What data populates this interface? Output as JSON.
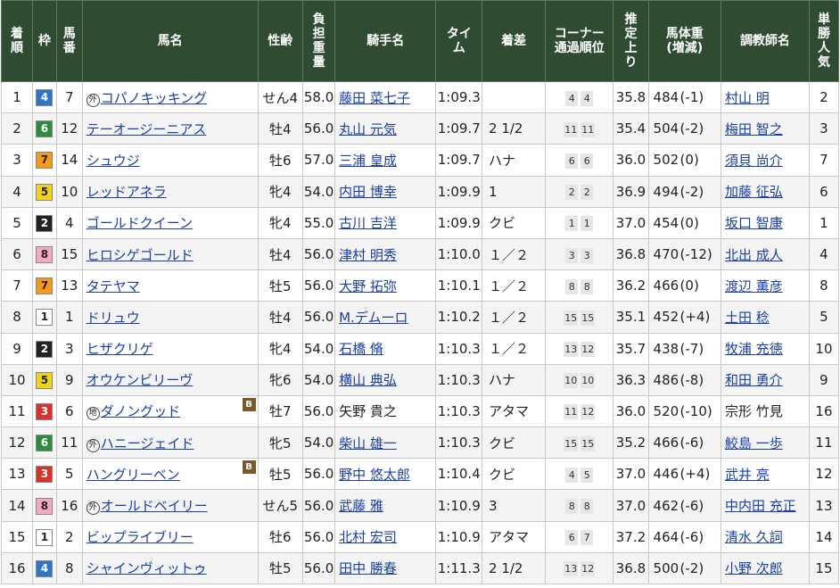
{
  "headers": {
    "rank": "着順",
    "waku": "枠",
    "umaban": "馬番",
    "horse": "馬名",
    "sexage": "性齢",
    "load": "負担重量",
    "jockey": "騎手名",
    "time": "タイム",
    "margin": "着差",
    "corner_1": "コーナー",
    "corner_2": "通過順位",
    "last3f": "推定上り",
    "weight_1": "馬体重",
    "weight_2": "(増減)",
    "trainer": "調教師名",
    "pop": "単勝人気"
  },
  "colors": {
    "header_bg": "#2f4c33",
    "link": "#1a3fa8",
    "blinker": "#7a5a2a"
  },
  "waku_colors": {
    "1": {
      "bg": "#ffffff",
      "fg": "#222222"
    },
    "2": {
      "bg": "#222222",
      "fg": "#ffffff"
    },
    "3": {
      "bg": "#d9312b",
      "fg": "#ffffff"
    },
    "4": {
      "bg": "#2f74c8",
      "fg": "#ffffff"
    },
    "5": {
      "bg": "#f1d21c",
      "fg": "#222222"
    },
    "6": {
      "bg": "#2e8c3e",
      "fg": "#ffffff"
    },
    "7": {
      "bg": "#f39a1d",
      "fg": "#222222"
    },
    "8": {
      "bg": "#f4a9c1",
      "fg": "#222222"
    }
  },
  "rows": [
    {
      "rank": "1",
      "waku": "4",
      "umaban": "7",
      "mark": "外",
      "horse": "コパノキッキング",
      "blinker": "",
      "sex": "せん4",
      "load": "58.0",
      "jockey": "藤田 菜七子",
      "jockey_link": true,
      "time": "1:09.3",
      "margin": "",
      "c1": "4",
      "c2": "4",
      "last3f": "35.8",
      "weight": "484",
      "diff": "(-1)",
      "trainer": "村山 明",
      "trainer_link": true,
      "pop": "2"
    },
    {
      "rank": "2",
      "waku": "6",
      "umaban": "12",
      "mark": "",
      "horse": "テーオージーニアス",
      "blinker": "",
      "sex": "牡4",
      "load": "56.0",
      "jockey": "丸山 元気",
      "jockey_link": true,
      "time": "1:09.7",
      "margin": "2 1/2",
      "c1": "11",
      "c2": "11",
      "last3f": "35.4",
      "weight": "504",
      "diff": "(-2)",
      "trainer": "梅田 智之",
      "trainer_link": true,
      "pop": "3"
    },
    {
      "rank": "3",
      "waku": "7",
      "umaban": "14",
      "mark": "",
      "horse": "シュウジ",
      "blinker": "",
      "sex": "牡6",
      "load": "57.0",
      "jockey": "三浦 皇成",
      "jockey_link": true,
      "time": "1:09.7",
      "margin": "ハナ",
      "c1": "6",
      "c2": "6",
      "last3f": "36.0",
      "weight": "502",
      "diff": "(0)",
      "trainer": "須貝 尚介",
      "trainer_link": true,
      "pop": "7"
    },
    {
      "rank": "4",
      "waku": "5",
      "umaban": "10",
      "mark": "",
      "horse": "レッドアネラ",
      "blinker": "",
      "sex": "牝4",
      "load": "54.0",
      "jockey": "内田 博幸",
      "jockey_link": true,
      "time": "1:09.9",
      "margin": "1",
      "c1": "2",
      "c2": "2",
      "last3f": "36.9",
      "weight": "494",
      "diff": "(-2)",
      "trainer": "加藤 征弘",
      "trainer_link": true,
      "pop": "6"
    },
    {
      "rank": "5",
      "waku": "2",
      "umaban": "4",
      "mark": "",
      "horse": "ゴールドクイーン",
      "blinker": "",
      "sex": "牝4",
      "load": "55.0",
      "jockey": "古川 吉洋",
      "jockey_link": true,
      "time": "1:09.9",
      "margin": "クビ",
      "c1": "1",
      "c2": "1",
      "last3f": "37.0",
      "weight": "454",
      "diff": "(0)",
      "trainer": "坂口 智康",
      "trainer_link": true,
      "pop": "1"
    },
    {
      "rank": "6",
      "waku": "8",
      "umaban": "15",
      "mark": "",
      "horse": "ヒロシゲゴールド",
      "blinker": "",
      "sex": "牡4",
      "load": "56.0",
      "jockey": "津村 明秀",
      "jockey_link": true,
      "time": "1:10.0",
      "margin": "１／２",
      "c1": "3",
      "c2": "3",
      "last3f": "36.8",
      "weight": "470",
      "diff": "(-12)",
      "trainer": "北出 成人",
      "trainer_link": true,
      "pop": "4"
    },
    {
      "rank": "7",
      "waku": "7",
      "umaban": "13",
      "mark": "",
      "horse": "タテヤマ",
      "blinker": "",
      "sex": "牡5",
      "load": "56.0",
      "jockey": "大野 拓弥",
      "jockey_link": true,
      "time": "1:10.1",
      "margin": "１／２",
      "c1": "8",
      "c2": "8",
      "last3f": "36.2",
      "weight": "466",
      "diff": "(0)",
      "trainer": "渡辺 薫彦",
      "trainer_link": true,
      "pop": "8"
    },
    {
      "rank": "8",
      "waku": "1",
      "umaban": "1",
      "mark": "",
      "horse": "ドリュウ",
      "blinker": "",
      "sex": "牡4",
      "load": "56.0",
      "jockey": "M.デムーロ",
      "jockey_link": true,
      "time": "1:10.2",
      "margin": "１／２",
      "c1": "15",
      "c2": "15",
      "last3f": "35.1",
      "weight": "452",
      "diff": "(+4)",
      "trainer": "土田 稔",
      "trainer_link": true,
      "pop": "5"
    },
    {
      "rank": "9",
      "waku": "2",
      "umaban": "3",
      "mark": "",
      "horse": "ヒザクリゲ",
      "blinker": "",
      "sex": "牝4",
      "load": "54.0",
      "jockey": "石橋 脩",
      "jockey_link": true,
      "time": "1:10.3",
      "margin": "１／２",
      "c1": "13",
      "c2": "12",
      "last3f": "35.7",
      "weight": "438",
      "diff": "(-7)",
      "trainer": "牧浦 充徳",
      "trainer_link": true,
      "pop": "10"
    },
    {
      "rank": "10",
      "waku": "5",
      "umaban": "9",
      "mark": "",
      "horse": "オウケンビリーヴ",
      "blinker": "",
      "sex": "牝6",
      "load": "54.0",
      "jockey": "横山 典弘",
      "jockey_link": true,
      "time": "1:10.3",
      "margin": "ハナ",
      "c1": "10",
      "c2": "10",
      "last3f": "36.3",
      "weight": "486",
      "diff": "(-8)",
      "trainer": "和田 勇介",
      "trainer_link": true,
      "pop": "9"
    },
    {
      "rank": "11",
      "waku": "3",
      "umaban": "6",
      "mark": "地",
      "horse": "ダノングッド",
      "blinker": "B",
      "sex": "牡7",
      "load": "56.0",
      "jockey": "矢野 貴之",
      "jockey_link": false,
      "time": "1:10.3",
      "margin": "アタマ",
      "c1": "11",
      "c2": "12",
      "last3f": "36.0",
      "weight": "520",
      "diff": "(-10)",
      "trainer": "宗形 竹見",
      "trainer_link": false,
      "pop": "16"
    },
    {
      "rank": "12",
      "waku": "6",
      "umaban": "11",
      "mark": "外",
      "horse": "ハニージェイド",
      "blinker": "",
      "sex": "牝5",
      "load": "54.0",
      "jockey": "柴山 雄一",
      "jockey_link": true,
      "time": "1:10.3",
      "margin": "クビ",
      "c1": "15",
      "c2": "15",
      "last3f": "35.2",
      "weight": "466",
      "diff": "(-6)",
      "trainer": "鮫島 一歩",
      "trainer_link": true,
      "pop": "11"
    },
    {
      "rank": "13",
      "waku": "3",
      "umaban": "5",
      "mark": "",
      "horse": "ハングリーベン",
      "blinker": "B",
      "sex": "牡5",
      "load": "56.0",
      "jockey": "野中 悠太郎",
      "jockey_link": true,
      "time": "1:10.4",
      "margin": "クビ",
      "c1": "4",
      "c2": "5",
      "last3f": "37.0",
      "weight": "446",
      "diff": "(+4)",
      "trainer": "武井 亮",
      "trainer_link": true,
      "pop": "12"
    },
    {
      "rank": "14",
      "waku": "8",
      "umaban": "16",
      "mark": "外",
      "horse": "オールドベイリー",
      "blinker": "",
      "sex": "せん5",
      "load": "56.0",
      "jockey": "武藤 雅",
      "jockey_link": true,
      "time": "1:10.9",
      "margin": "3",
      "c1": "8",
      "c2": "8",
      "last3f": "37.0",
      "weight": "462",
      "diff": "(-6)",
      "trainer": "中内田 充正",
      "trainer_link": true,
      "pop": "13"
    },
    {
      "rank": "15",
      "waku": "1",
      "umaban": "2",
      "mark": "",
      "horse": "ビップライブリー",
      "blinker": "",
      "sex": "牡6",
      "load": "56.0",
      "jockey": "北村 宏司",
      "jockey_link": true,
      "time": "1:10.9",
      "margin": "アタマ",
      "c1": "6",
      "c2": "7",
      "last3f": "37.2",
      "weight": "464",
      "diff": "(-6)",
      "trainer": "清水 久詞",
      "trainer_link": true,
      "pop": "14"
    },
    {
      "rank": "16",
      "waku": "4",
      "umaban": "8",
      "mark": "",
      "horse": "シャインヴィットゥ",
      "blinker": "",
      "sex": "牡5",
      "load": "56.0",
      "jockey": "田中 勝春",
      "jockey_link": true,
      "time": "1:11.3",
      "margin": "2 1/2",
      "c1": "13",
      "c2": "12",
      "last3f": "36.8",
      "weight": "500",
      "diff": "(-2)",
      "trainer": "小野 次郎",
      "trainer_link": true,
      "pop": "15"
    }
  ]
}
